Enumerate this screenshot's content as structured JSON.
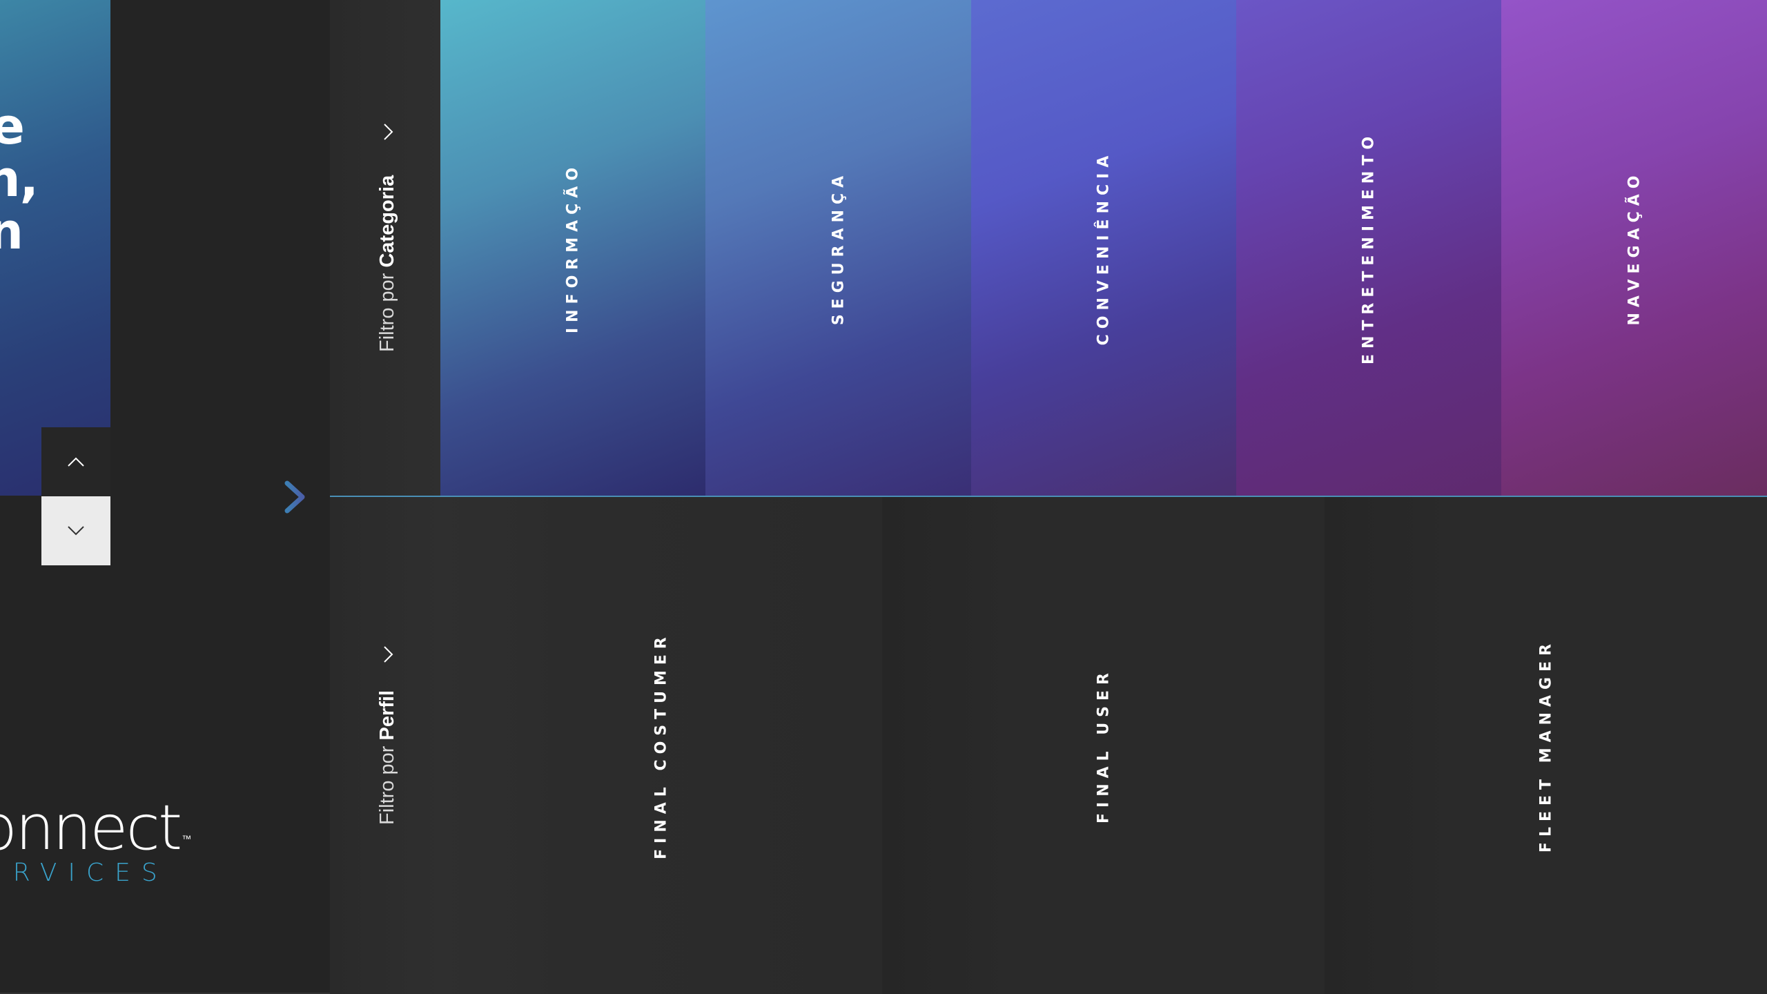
{
  "hero": {
    "lines": [
      "e",
      "h,",
      "n"
    ]
  },
  "nav": {
    "up_icon": "chevron-up-icon",
    "down_icon": "chevron-down-icon",
    "next_icon": "arrow-right-icon"
  },
  "logo": {
    "main": "onnect",
    "tm": "™",
    "sub": "ERVICES"
  },
  "filters": {
    "category": {
      "prefix": "Filtro por ",
      "strong": "Categoria"
    },
    "profile": {
      "prefix": "Filtro por ",
      "strong": "Perfil"
    }
  },
  "categories": [
    {
      "label": "INFORMAÇÃO"
    },
    {
      "label": "SEGURANÇA"
    },
    {
      "label": "CONVENIÊNCIA"
    },
    {
      "label": "ENTRETENIMENTO"
    },
    {
      "label": "NAVEGAÇÃO"
    }
  ],
  "profiles": [
    {
      "label": "FINAL COSTUMER"
    },
    {
      "label": "FINAL USER"
    },
    {
      "label": "FLEET MANAGER"
    }
  ],
  "colors": {
    "accent": "#3aa3cc",
    "divider": "#4a8fb6",
    "background": "#242424"
  }
}
